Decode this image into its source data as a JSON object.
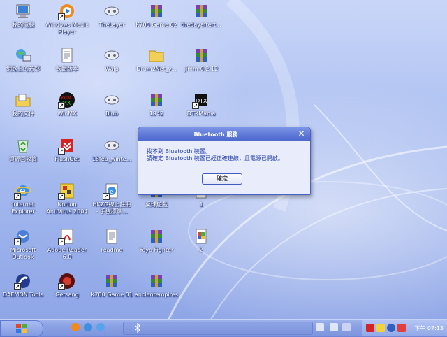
{
  "desktop": {
    "icons": [
      {
        "label": "我的電腦",
        "icon": "computer-icon"
      },
      {
        "label": "Windows Media",
        "label2": "Player",
        "icon": "media-player-icon"
      },
      {
        "label": "TheLayer",
        "icon": "film-reel-icon"
      },
      {
        "label": "K700 Game 02",
        "icon": "winrar-archive-icon"
      },
      {
        "label": "thedayaftert...",
        "icon": "winrar-archive-icon"
      },
      {
        "label": "網路上的芳鄰",
        "icon": "network-icon"
      },
      {
        "label": "軟體版本",
        "icon": "text-document-icon"
      },
      {
        "label": "Waip",
        "icon": "film-reel-icon"
      },
      {
        "label": "Drum2Net_v...",
        "icon": "folder-icon"
      },
      {
        "label": "jimm-0.2.12",
        "icon": "winrar-archive-icon"
      },
      {
        "label": "我的文件",
        "icon": "my-documents-folder-icon"
      },
      {
        "label": "WinMX",
        "icon": "winmx-icon"
      },
      {
        "label": "Blub",
        "icon": "film-reel-icon"
      },
      {
        "label": "1942",
        "icon": "winrar-archive-icon"
      },
      {
        "label": "DTXMania",
        "icon": "dtxmania-icon"
      },
      {
        "label": "資源回收筒",
        "icon": "recycle-bin-icon"
      },
      {
        "label": "FlashGet",
        "icon": "flashget-icon"
      },
      {
        "label": "18feb_winte...",
        "icon": "film-reel-icon"
      },
      {
        "label": "Internet",
        "label2": "Explorer",
        "icon": "internet-explorer-icon"
      },
      {
        "label": "Norton",
        "label2": "AntiVirus 2004",
        "icon": "norton-antivirus-icon"
      },
      {
        "label": "HKZG線上註冊",
        "label2": "- 手機標準...",
        "icon": "web-shortcut-icon"
      },
      {
        "label": "桌球遊戲",
        "icon": "winrar-archive-icon"
      },
      {
        "label": "1",
        "icon": "image-file-icon"
      },
      {
        "label": "Microsoft",
        "label2": "Outlook",
        "icon": "outlook-icon"
      },
      {
        "label": "Adobe Reader",
        "label2": "6.0",
        "icon": "adobe-reader-icon"
      },
      {
        "label": "readme",
        "icon": "text-document-icon"
      },
      {
        "label": "Yoyo Fighter",
        "icon": "winrar-archive-icon"
      },
      {
        "label": "2",
        "icon": "image-file-icon"
      },
      {
        "label": "DAEMON Tools",
        "icon": "daemon-tools-icon"
      },
      {
        "label": "Gersang",
        "icon": "gersang-icon"
      },
      {
        "label": "K700 Game 01",
        "icon": "winrar-archive-icon"
      },
      {
        "label": "ancientempires",
        "icon": "winrar-archive-icon"
      }
    ]
  },
  "dialog": {
    "title": "Bluetooth 服務",
    "close_symbol": "✕",
    "message_line1": "找不到 Bluetooth 裝置。",
    "message_line2": "請確定 Bluetooth 裝置已經正確連線，且電源已開啟。",
    "ok_label": "確定"
  },
  "taskbar": {
    "clock": "下午 07:13"
  },
  "colors": {
    "dialog_text": "#1c37a8",
    "titlebar": "#5b76d6",
    "taskbar": "#8aa1e4"
  }
}
